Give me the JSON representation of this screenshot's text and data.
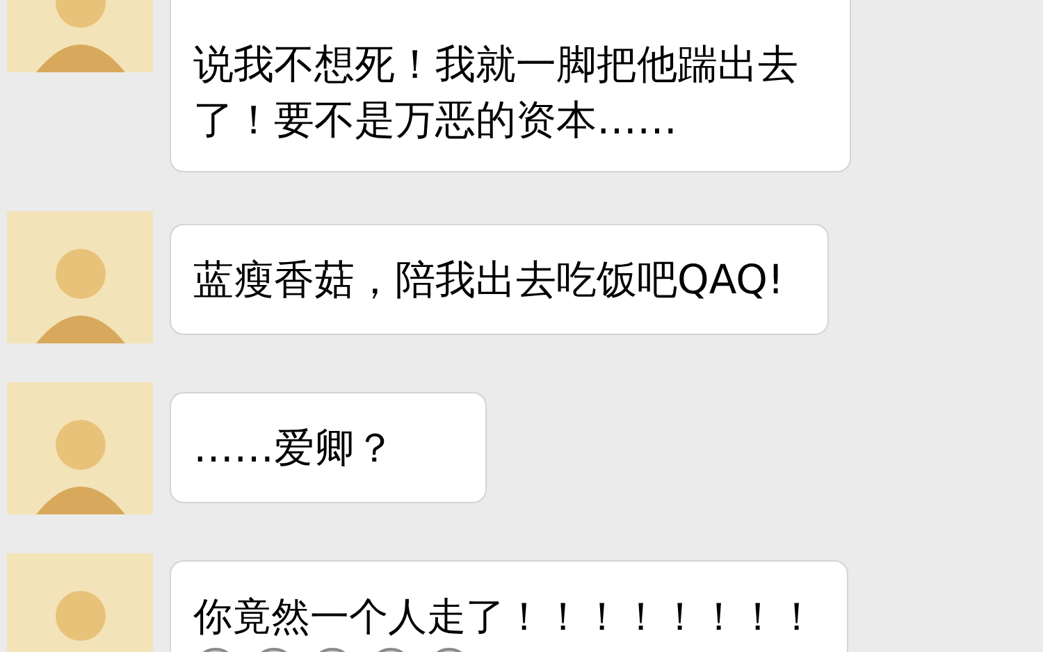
{
  "messages": [
    {
      "kind": "text",
      "text": "说我不想死！我就一脚把他踹出去了！要不是万恶的资本……"
    },
    {
      "kind": "text",
      "text": "蓝瘦香菇，陪我出去吃饭吧QAQ!"
    },
    {
      "kind": "text",
      "text": "……爱卿？"
    },
    {
      "kind": "text_with_emoji",
      "text": "你竟然一个人走了！！！！！！！！"
    }
  ]
}
